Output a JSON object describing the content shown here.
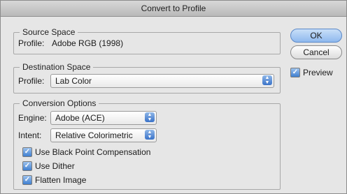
{
  "window": {
    "title": "Convert to Profile"
  },
  "source": {
    "legend": "Source Space",
    "profile_label": "Profile:",
    "profile_value": "Adobe RGB (1998)"
  },
  "destination": {
    "legend": "Destination Space",
    "profile_label": "Profile:",
    "profile_value": "Lab Color"
  },
  "conversion": {
    "legend": "Conversion Options",
    "engine_label": "Engine:",
    "engine_value": "Adobe (ACE)",
    "intent_label": "Intent:",
    "intent_value": "Relative Colorimetric",
    "options": [
      {
        "label": "Use Black Point Compensation",
        "checked": true
      },
      {
        "label": "Use Dither",
        "checked": true
      },
      {
        "label": "Flatten Image",
        "checked": true
      }
    ]
  },
  "buttons": {
    "ok": "OK",
    "cancel": "Cancel"
  },
  "preview": {
    "label": "Preview",
    "checked": true
  },
  "icons": {
    "checkmark": "checkmark-icon",
    "select_arrows": "up-down-arrows-icon"
  },
  "colors": {
    "accent": "#3f7fd0"
  }
}
